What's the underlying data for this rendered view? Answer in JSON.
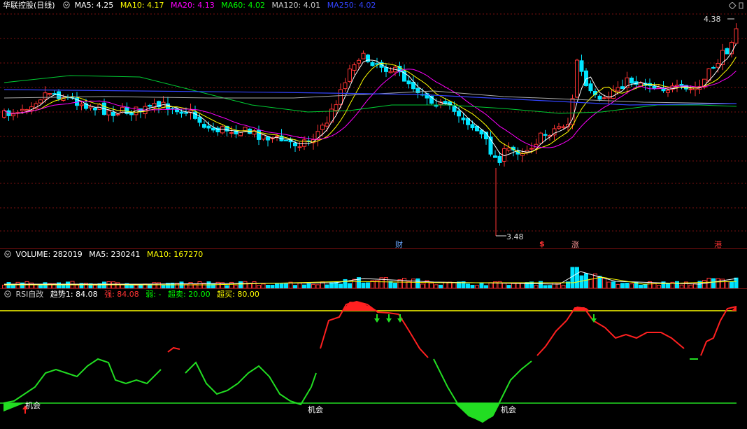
{
  "main": {
    "title": "华联控股(日线)",
    "indicators": [
      {
        "label": "MA5: 4.25",
        "color": "#ffffff"
      },
      {
        "label": "MA10: 4.17",
        "color": "#ffff00"
      },
      {
        "label": "MA20: 4.13",
        "color": "#ff00ff"
      },
      {
        "label": "MA60: 4.02",
        "color": "#00ff00"
      },
      {
        "label": "MA120: 4.01",
        "color": "#cccccc"
      },
      {
        "label": "MA250: 4.02",
        "color": "#3344ff"
      }
    ],
    "high_label": "4.38",
    "low_label": "3.48",
    "markers": [
      {
        "text": "财",
        "color": "#6aa7ff"
      },
      {
        "text": "$",
        "color": "#ff3333"
      },
      {
        "text": "涨",
        "color": "#ff9999"
      },
      {
        "text": "港",
        "color": "#ff3333"
      }
    ]
  },
  "volume": {
    "indicators": [
      {
        "label": "VOLUME: 282019",
        "color": "#ffffff"
      },
      {
        "label": "MA5: 230241",
        "color": "#ffffff"
      },
      {
        "label": "MA10: 167270",
        "color": "#ffff00"
      }
    ]
  },
  "rsi": {
    "indicators": [
      {
        "label": "RSI自改",
        "color": "#cccccc"
      },
      {
        "label": "趋势1: 84.08",
        "color": "#ffffff"
      },
      {
        "label": "强: 84.08",
        "color": "#ff3333"
      },
      {
        "label": "弱: -",
        "color": "#00ff00"
      },
      {
        "label": "超卖: 20.00",
        "color": "#00ff00"
      },
      {
        "label": "超买: 80.00",
        "color": "#ffff00"
      }
    ],
    "signal_labels": [
      "机会",
      "机会",
      "机会"
    ],
    "overbought": 80,
    "oversold": 20
  },
  "colors": {
    "up": "#ff3333",
    "down": "#00e5ff",
    "grid": "#7a1010",
    "rsi_strong": "#ff2020",
    "rsi_weak": "#22dd22"
  }
}
